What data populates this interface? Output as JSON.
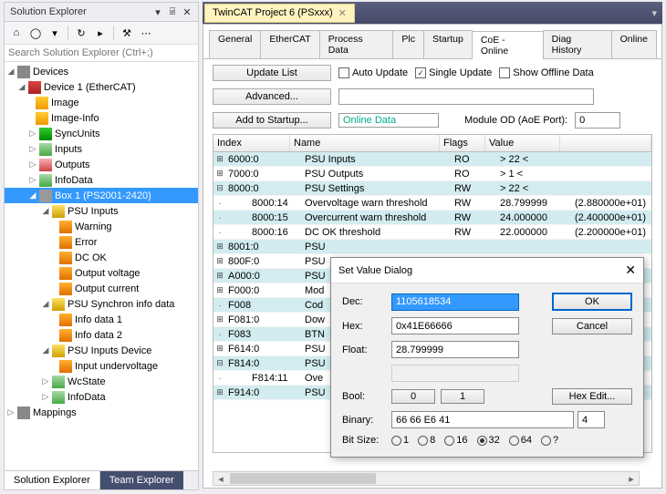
{
  "solution_explorer": {
    "title": "Solution Explorer",
    "search_placeholder": "Search Solution Explorer (Ctrl+;)",
    "bottom_tabs": {
      "active": "Solution Explorer",
      "inactive": "Team Explorer"
    },
    "tree": {
      "root": "Devices",
      "device": "Device 1 (EtherCAT)",
      "image": "Image",
      "image_info": "Image-Info",
      "syncunits": "SyncUnits",
      "inputs": "Inputs",
      "outputs": "Outputs",
      "infodata": "InfoData",
      "box": "Box 1 (PS2001-2420)",
      "psu_inputs": "PSU Inputs",
      "warning": "Warning",
      "error": "Error",
      "dc_ok": "DC OK",
      "output_voltage": "Output voltage",
      "output_current": "Output current",
      "psu_sync": "PSU Synchron info data",
      "info1": "Info data 1",
      "info2": "Info data 2",
      "psu_dev": "PSU Inputs Device",
      "undervolt": "Input undervoltage",
      "wcstate": "WcState",
      "infodata2": "InfoData",
      "mappings": "Mappings"
    }
  },
  "doc": {
    "tab_title": "TwinCAT Project 6 (PSxxx)",
    "inner_tabs": [
      "General",
      "EtherCAT",
      "Process Data",
      "Plc",
      "Startup",
      "CoE - Online",
      "Diag History",
      "Online"
    ],
    "active_inner": "CoE - Online",
    "buttons": {
      "update": "Update List",
      "advanced": "Advanced...",
      "startup": "Add to Startup..."
    },
    "checks": {
      "auto": "Auto Update",
      "single": "Single Update",
      "offline": "Show Offline Data"
    },
    "online_data": "Online Data",
    "module_label": "Module OD (AoE Port):",
    "module_value": "0",
    "columns": {
      "index": "Index",
      "name": "Name",
      "flags": "Flags",
      "value": "Value",
      "unit": ""
    },
    "rows": [
      {
        "exp": "+",
        "idx": "6000:0",
        "name": "PSU Inputs",
        "flags": "RO",
        "val": "> 22 <",
        "unit": "",
        "hl": true
      },
      {
        "exp": "+",
        "idx": "7000:0",
        "name": "PSU Outputs",
        "flags": "RO",
        "val": "> 1 <",
        "unit": ""
      },
      {
        "exp": "−",
        "idx": "8000:0",
        "name": "PSU Settings",
        "flags": "RW",
        "val": "> 22 <",
        "unit": "",
        "hl": true
      },
      {
        "exp": "",
        "idx": "8000:14",
        "name": "Overvoltage warn threshold",
        "flags": "RW",
        "val": "28.799999",
        "unit": "(2.880000e+01)",
        "indent": true
      },
      {
        "exp": "",
        "idx": "8000:15",
        "name": "Overcurrent warn threshold",
        "flags": "RW",
        "val": "24.000000",
        "unit": "(2.400000e+01)",
        "indent": true,
        "hl": true
      },
      {
        "exp": "",
        "idx": "8000:16",
        "name": "DC OK threshold",
        "flags": "RW",
        "val": "22.000000",
        "unit": "(2.200000e+01)",
        "indent": true
      },
      {
        "exp": "+",
        "idx": "8001:0",
        "name": "PSU",
        "flags": "",
        "val": "",
        "unit": "",
        "hl": true
      },
      {
        "exp": "+",
        "idx": "800F:0",
        "name": "PSU",
        "flags": "",
        "val": "",
        "unit": ""
      },
      {
        "exp": "+",
        "idx": "A000:0",
        "name": "PSU",
        "flags": "",
        "val": "",
        "unit": "",
        "hl": true
      },
      {
        "exp": "+",
        "idx": "F000:0",
        "name": "Mod",
        "flags": "",
        "val": "",
        "unit": ""
      },
      {
        "exp": "",
        "idx": "F008",
        "name": "Cod",
        "flags": "",
        "val": "",
        "unit": "",
        "hl": true
      },
      {
        "exp": "+",
        "idx": "F081:0",
        "name": "Dow",
        "flags": "",
        "val": "",
        "unit": ""
      },
      {
        "exp": "",
        "idx": "F083",
        "name": "BTN",
        "flags": "",
        "val": "",
        "unit": "",
        "hl": true
      },
      {
        "exp": "+",
        "idx": "F614:0",
        "name": "PSU",
        "flags": "",
        "val": "",
        "unit": ""
      },
      {
        "exp": "−",
        "idx": "F814:0",
        "name": "PSU",
        "flags": "",
        "val": "",
        "unit": "",
        "hl": true
      },
      {
        "exp": "",
        "idx": "F814:11",
        "name": "Ove",
        "flags": "",
        "val": "",
        "unit": "",
        "indent": true
      },
      {
        "exp": "+",
        "idx": "F914:0",
        "name": "PSU",
        "flags": "",
        "val": "",
        "unit": "",
        "hl": true
      }
    ]
  },
  "dialog": {
    "title": "Set Value Dialog",
    "labels": {
      "dec": "Dec:",
      "hex": "Hex:",
      "float": "Float:",
      "bool": "Bool:",
      "binary": "Binary:",
      "bitsize": "Bit Size:"
    },
    "values": {
      "dec": "1105618534",
      "hex": "0x41E66666",
      "float": "28.799999",
      "binary": "66 66 E6 41",
      "binary_len": "4"
    },
    "buttons": {
      "ok": "OK",
      "cancel": "Cancel",
      "hexedit": "Hex Edit...",
      "b0": "0",
      "b1": "1"
    },
    "bits": [
      "1",
      "8",
      "16",
      "32",
      "64",
      "?"
    ],
    "bit_selected": "32"
  }
}
